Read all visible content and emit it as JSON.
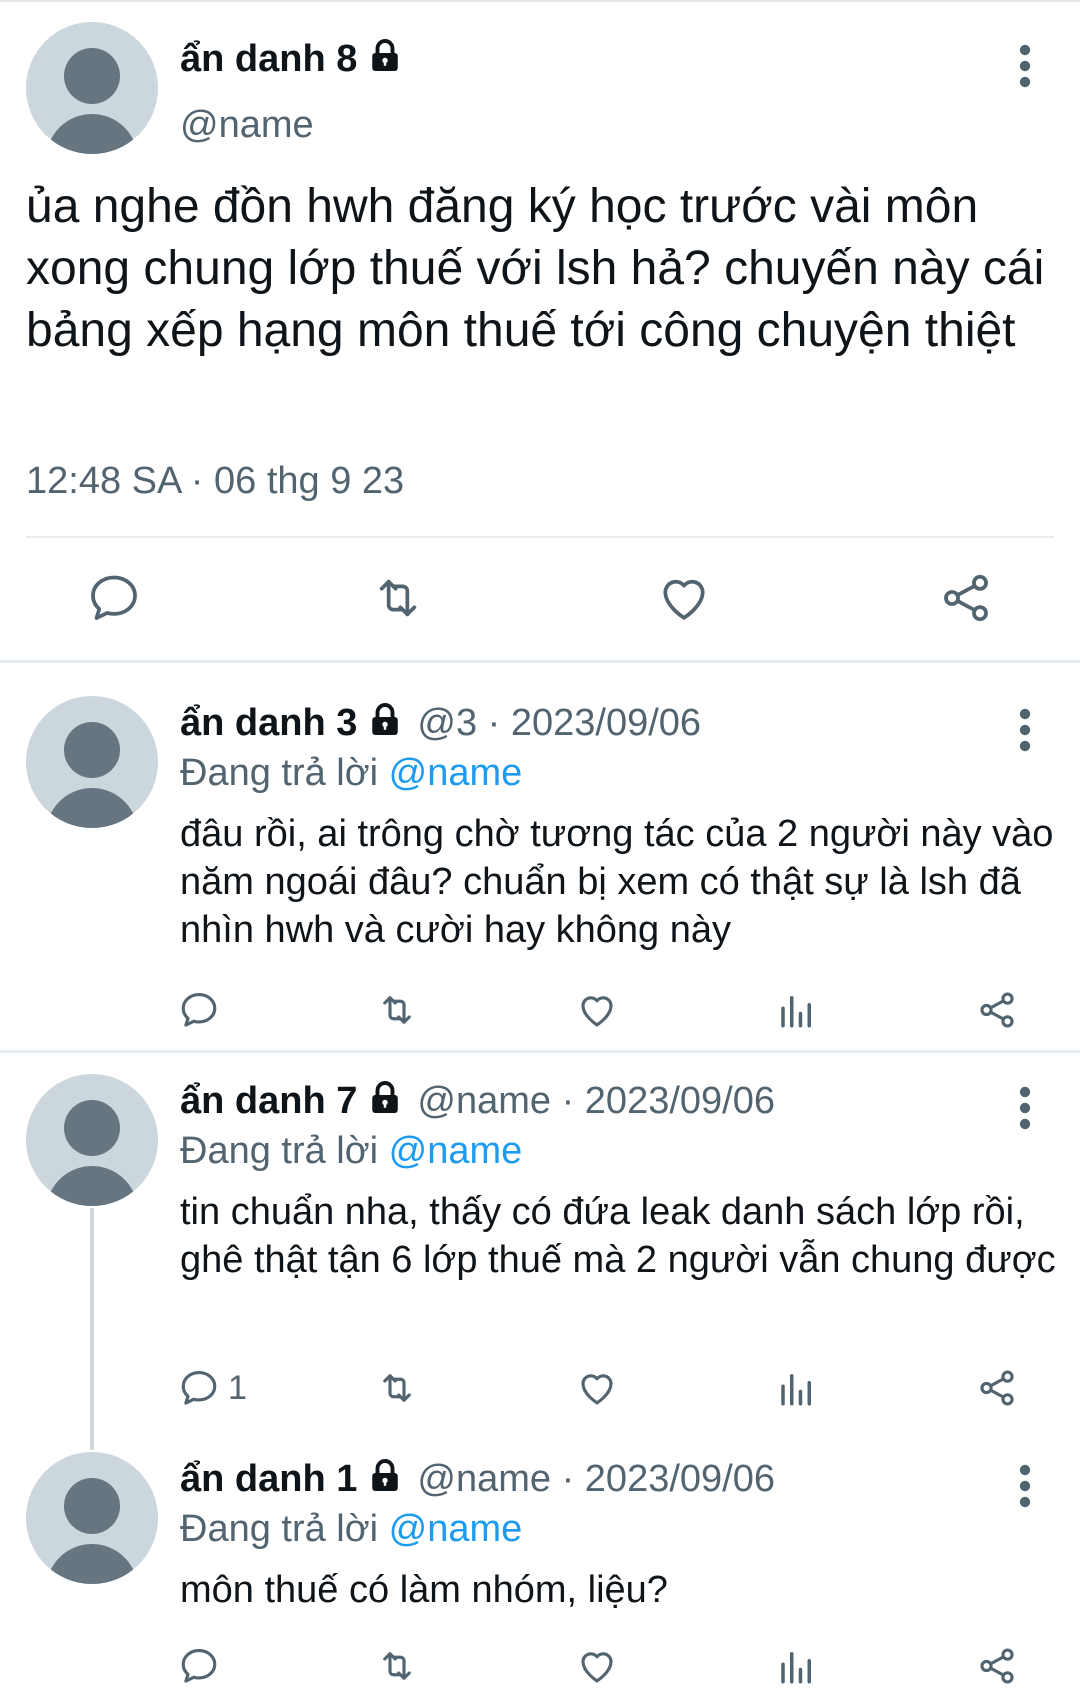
{
  "main_tweet": {
    "author_name": "ẩn danh 8",
    "handle": "@name",
    "text": "ủa nghe đồn hwh đăng ký học trước vài môn xong chung lớp thuế với lsh hả? chuyến này cái bảng xếp hạng môn thuế tới công chuyện thiệt",
    "timestamp": "12:48 SA · 06 thg 9 23",
    "actions": [
      "reply-icon",
      "retweet-icon",
      "like-icon",
      "share-icon"
    ]
  },
  "replies": [
    {
      "author_name": "ẩn danh 3",
      "handle": "@3",
      "separator": " · ",
      "date": "2023/09/06",
      "replying_prefix": "Đang trả lời ",
      "replying_to": "@name",
      "text": "đâu rồi, ai trông chờ tương tác của 2 người này vào năm ngoái đâu? chuẩn bị xem có thật sự là lsh đã nhìn hwh và cười hay không này",
      "reply_count": ""
    },
    {
      "author_name": "ẩn danh 7",
      "handle": "@name",
      "separator": " · ",
      "date": "2023/09/06",
      "replying_prefix": "Đang trả lời ",
      "replying_to": "@name",
      "text": "tin chuẩn nha, thấy có đứa leak danh sách lớp rồi, ghê thật tận 6 lớp thuế mà 2 người vẫn chung được",
      "reply_count": "1"
    },
    {
      "author_name": "ẩn danh 1",
      "handle": "@name",
      "separator": " · ",
      "date": "2023/09/06",
      "replying_prefix": "Đang trả lời ",
      "replying_to": "@name",
      "text": "môn thuế có làm nhóm, liệu?",
      "reply_count": ""
    }
  ],
  "colors": {
    "text": "#0f1419",
    "muted": "#536471",
    "mention": "#1d9bf0",
    "avatar_bg": "#ccd6dd",
    "avatar_fg": "#66757f"
  }
}
